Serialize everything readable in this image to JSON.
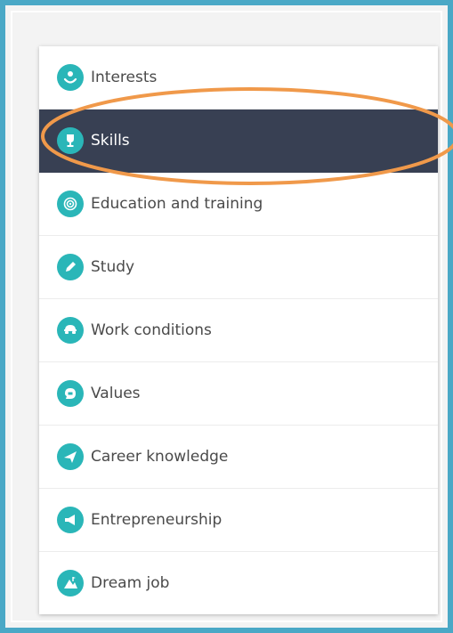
{
  "menu": {
    "items": [
      {
        "label": "Interests",
        "icon": "interests-icon"
      },
      {
        "label": "Skills",
        "icon": "skills-icon",
        "active": true
      },
      {
        "label": "Education and training",
        "icon": "education-icon"
      },
      {
        "label": "Study",
        "icon": "study-icon"
      },
      {
        "label": "Work conditions",
        "icon": "work-conditions-icon"
      },
      {
        "label": "Values",
        "icon": "values-icon"
      },
      {
        "label": "Career knowledge",
        "icon": "career-knowledge-icon"
      },
      {
        "label": "Entrepreneurship",
        "icon": "entrepreneurship-icon"
      },
      {
        "label": "Dream job",
        "icon": "dream-job-icon"
      }
    ]
  },
  "colors": {
    "frame_border": "#4aa8c6",
    "background": "#f3f3f3",
    "active_bg": "#384053",
    "icon_bg": "#2ab6b8",
    "highlight_ring": "#f0994a",
    "text": "#4a4a4a"
  }
}
